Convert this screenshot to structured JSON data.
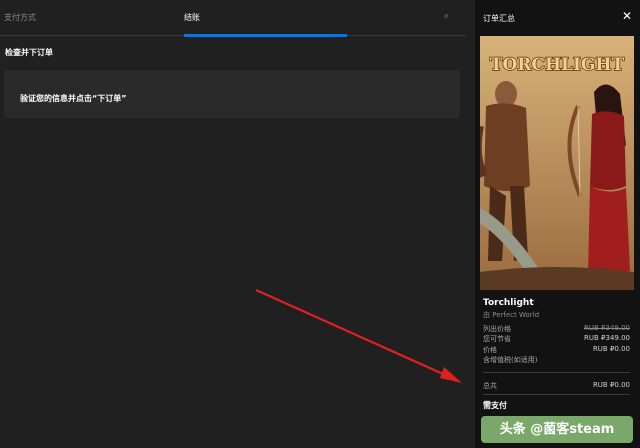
{
  "tabs": {
    "payment_label": "支付方式",
    "checkout_label": "结账",
    "icon": "gift-icon"
  },
  "review": {
    "title": "检查并下订单",
    "verify_text": "验证您的信息并点击“下订单”"
  },
  "summary": {
    "title": "订单汇总",
    "close_icon": "close-icon",
    "cover_logo": "TORCHLIGHT",
    "product_name": "Torchlight",
    "publisher": "由 Perfect World",
    "rows": [
      {
        "label": "列出价格",
        "value": "RUB ₽349.00"
      },
      {
        "label": "您可节省",
        "value": "RUB ₽349.00"
      },
      {
        "label": "价格",
        "value": "RUB ₽0.00"
      },
      {
        "label": "含增值税(如适用)",
        "value": ""
      }
    ],
    "total_label": "总共",
    "total_value": "RUB ₽0.00",
    "pay_label": "需支付"
  },
  "watermark": "头条 @菌客steam",
  "colors": {
    "accent": "#0078f2",
    "annotation_arrow": "#e02020"
  }
}
